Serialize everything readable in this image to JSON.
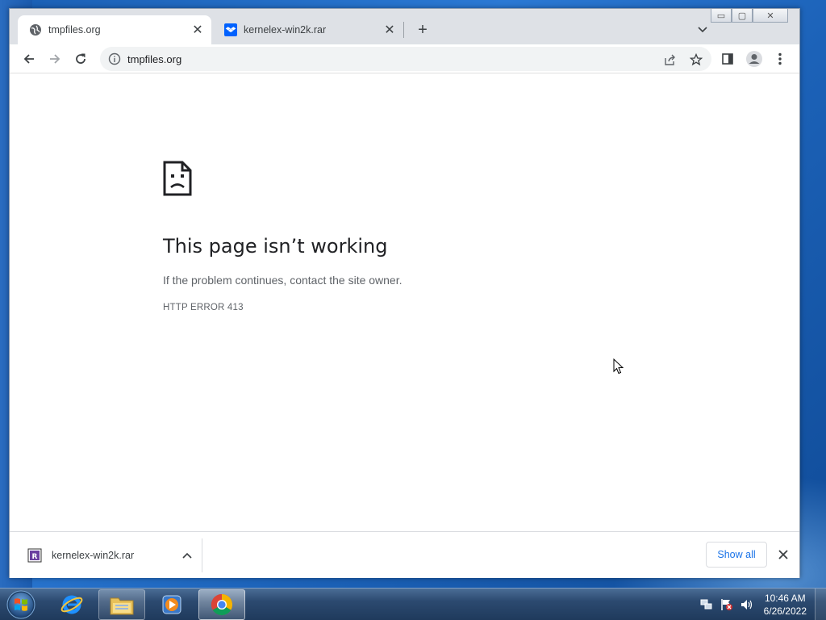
{
  "browser": {
    "tabs": [
      {
        "title": "tmpfiles.org",
        "active": true,
        "favicon": "globe-icon"
      },
      {
        "title": "kernelex-win2k.rar",
        "active": false,
        "favicon": "dropbox-icon"
      }
    ],
    "address": {
      "url": "tmpfiles.org"
    },
    "window_controls": {
      "minimize": "▭",
      "maximize": "▢",
      "close": "✕"
    }
  },
  "error_page": {
    "title": "This page isn’t working",
    "description": "If the problem continues, contact the site owner.",
    "code": "HTTP ERROR 413"
  },
  "download_bar": {
    "file_name": "kernelex-win2k.rar",
    "show_all_label": "Show all"
  },
  "taskbar": {
    "apps": [
      "internet-explorer",
      "windows-explorer",
      "media-player",
      "chrome"
    ],
    "clock": {
      "time": "10:46 AM",
      "date": "6/26/2022"
    }
  },
  "colors": {
    "accent": "#1a73e8",
    "taskbar": "#2c4a70",
    "desktop": "#1a5fb4"
  }
}
